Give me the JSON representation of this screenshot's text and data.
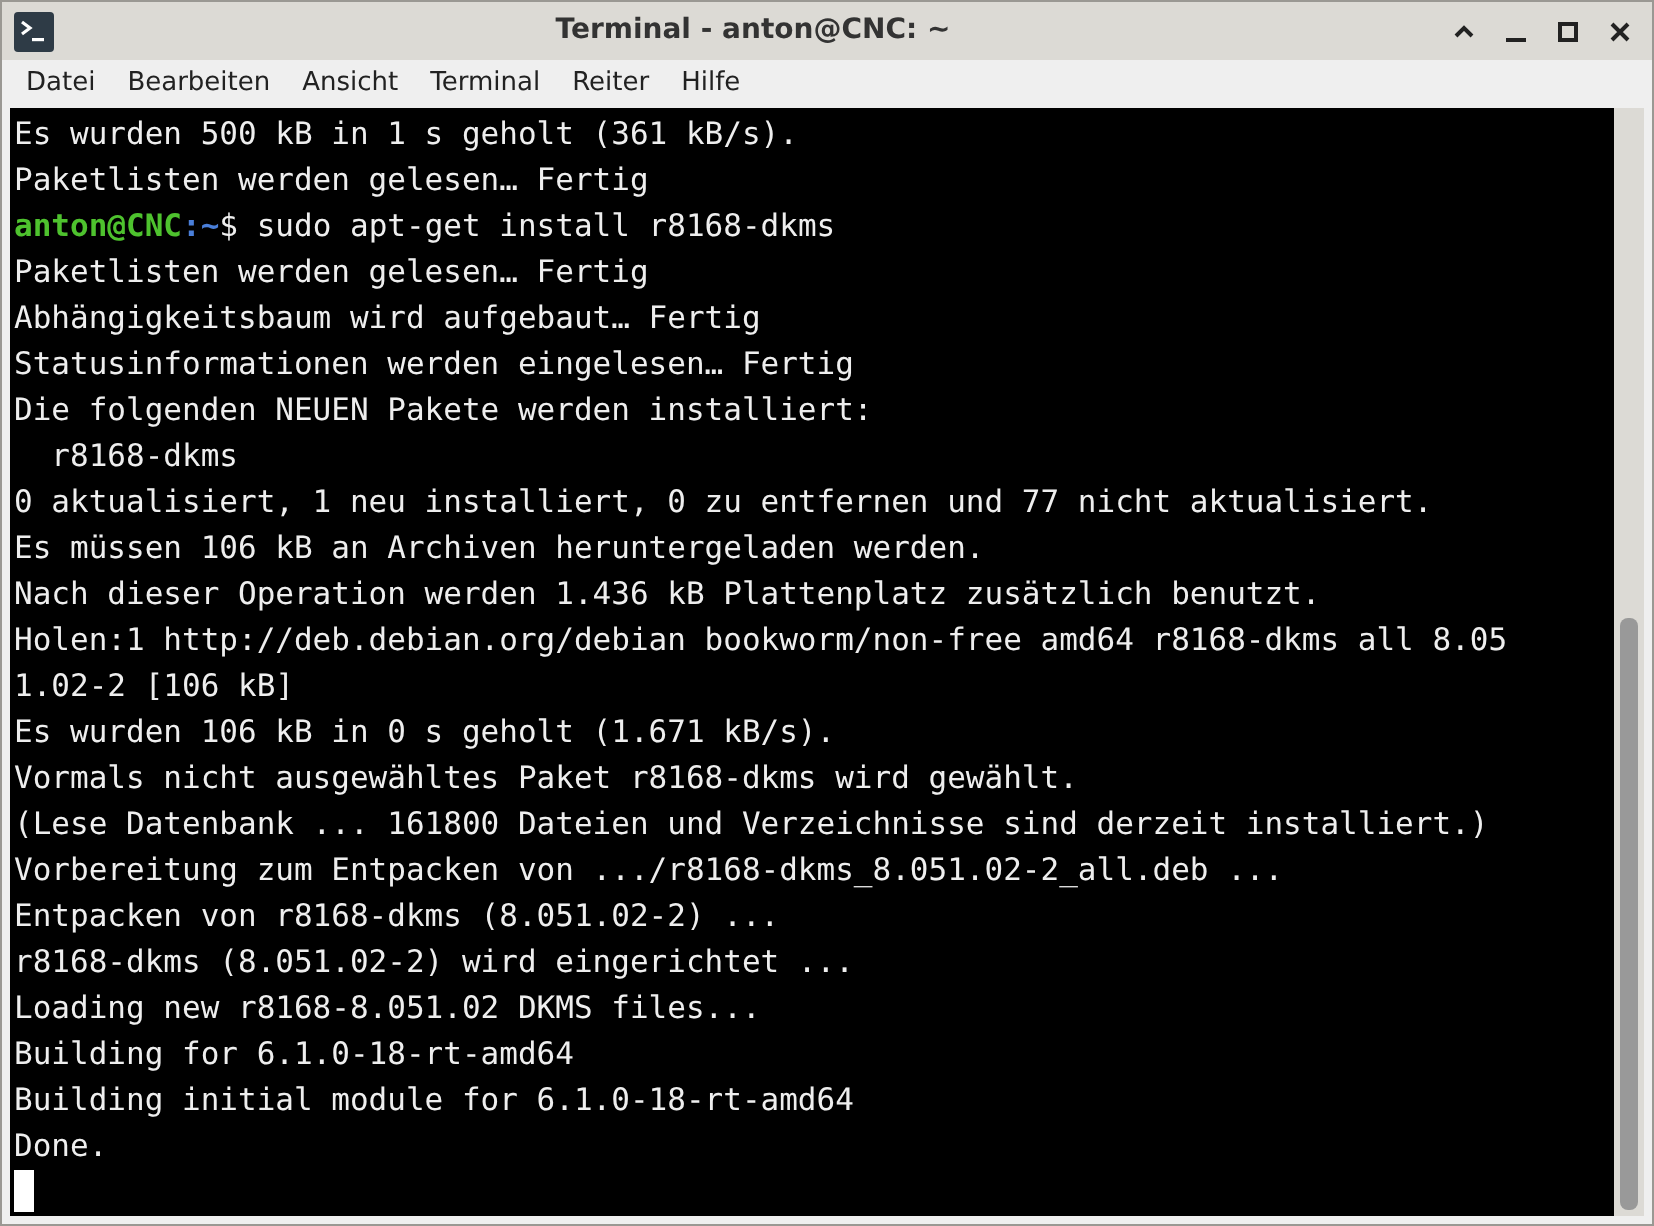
{
  "window": {
    "title": "Terminal - anton@CNC: ~"
  },
  "menu": [
    "Datei",
    "Bearbeiten",
    "Ansicht",
    "Terminal",
    "Reiter",
    "Hilfe"
  ],
  "terminal": {
    "lines": [
      {
        "kind": "output",
        "text": "Es wurden 500 kB in 1 s geholt (361 kB/s)."
      },
      {
        "kind": "output",
        "text": "Paketlisten werden gelesen… Fertig"
      },
      {
        "kind": "prompt",
        "user": "anton@CNC",
        "path": ":~",
        "command": "$ sudo apt-get install r8168-dkms"
      },
      {
        "kind": "output",
        "text": "Paketlisten werden gelesen… Fertig"
      },
      {
        "kind": "output",
        "text": "Abhängigkeitsbaum wird aufgebaut… Fertig"
      },
      {
        "kind": "output",
        "text": "Statusinformationen werden eingelesen… Fertig"
      },
      {
        "kind": "output",
        "text": "Die folgenden NEUEN Pakete werden installiert:"
      },
      {
        "kind": "output",
        "text": "  r8168-dkms"
      },
      {
        "kind": "output",
        "text": "0 aktualisiert, 1 neu installiert, 0 zu entfernen und 77 nicht aktualisiert."
      },
      {
        "kind": "output",
        "text": "Es müssen 106 kB an Archiven heruntergeladen werden."
      },
      {
        "kind": "output",
        "text": "Nach dieser Operation werden 1.436 kB Plattenplatz zusätzlich benutzt."
      },
      {
        "kind": "output",
        "text": "Holen:1 http://deb.debian.org/debian bookworm/non-free amd64 r8168-dkms all 8.05"
      },
      {
        "kind": "output",
        "text": "1.02-2 [106 kB]"
      },
      {
        "kind": "output",
        "text": "Es wurden 106 kB in 0 s geholt (1.671 kB/s)."
      },
      {
        "kind": "output",
        "text": "Vormals nicht ausgewähltes Paket r8168-dkms wird gewählt."
      },
      {
        "kind": "output",
        "text": "(Lese Datenbank ... 161800 Dateien und Verzeichnisse sind derzeit installiert.)"
      },
      {
        "kind": "output",
        "text": "Vorbereitung zum Entpacken von .../r8168-dkms_8.051.02-2_all.deb ..."
      },
      {
        "kind": "output",
        "text": "Entpacken von r8168-dkms (8.051.02-2) ..."
      },
      {
        "kind": "output",
        "text": "r8168-dkms (8.051.02-2) wird eingerichtet ..."
      },
      {
        "kind": "output",
        "text": "Loading new r8168-8.051.02 DKMS files..."
      },
      {
        "kind": "output",
        "text": "Building for 6.1.0-18-rt-amd64"
      },
      {
        "kind": "output",
        "text": "Building initial module for 6.1.0-18-rt-amd64"
      },
      {
        "kind": "output",
        "text": "Done."
      },
      {
        "kind": "cursor"
      }
    ]
  }
}
